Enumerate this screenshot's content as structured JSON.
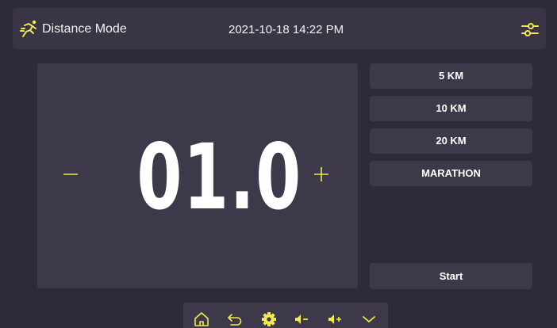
{
  "header": {
    "mode_icon": "runner-icon",
    "title": "Distance Mode",
    "datetime": "2021-10-18 14:22 PM",
    "settings_icon": "sliders-icon"
  },
  "display": {
    "value": "01.0",
    "minus_icon": "minus-icon",
    "plus_icon": "plus-icon"
  },
  "presets": [
    {
      "label": "5 KM"
    },
    {
      "label": "10 KM"
    },
    {
      "label": "20 KM"
    },
    {
      "label": "MARATHON"
    }
  ],
  "start_label": "Start",
  "navbar": {
    "items": [
      {
        "icon": "home-icon"
      },
      {
        "icon": "back-icon"
      },
      {
        "icon": "gear-icon"
      },
      {
        "icon": "volume-down-icon"
      },
      {
        "icon": "volume-up-icon"
      },
      {
        "icon": "chevron-down-icon"
      }
    ]
  },
  "colors": {
    "background": "#2e2b38",
    "panel": "#3d394a",
    "header": "#393545",
    "accent": "#f2e94e",
    "text": "#ffffff"
  }
}
